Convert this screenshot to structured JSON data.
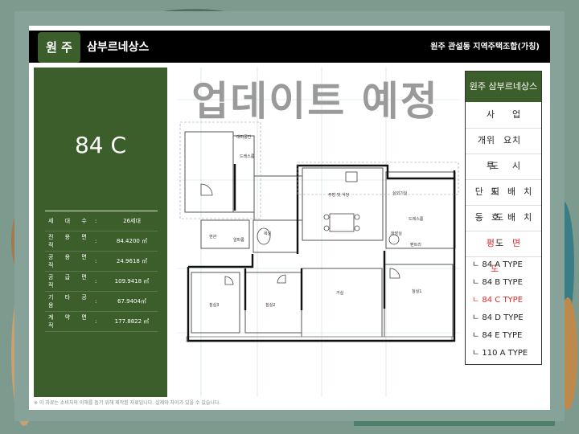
{
  "header": {
    "logo": "원 주",
    "brand": "삼부르네상스",
    "association": "원주 관설동 지역주택조합(가칭)"
  },
  "unit": {
    "type": "84 C",
    "specs": [
      {
        "label": "세 대 수",
        "value": "26세대"
      },
      {
        "label": "전 용 면 적",
        "value": "84.4200 ㎡"
      },
      {
        "label": "공 용 면 적",
        "value": "24.9618 ㎡"
      },
      {
        "label": "공 급 면 적",
        "value": "109.9418 ㎡"
      },
      {
        "label": "기 타 공 용",
        "value": "67.9404㎡"
      },
      {
        "label": "계 약 면 적",
        "value": "177.8822 ㎡"
      }
    ],
    "spec_colon": ":"
  },
  "plan": {
    "overlay": "업데이트 예정",
    "rooms": {
      "dress": "드레스룸",
      "kitchen": "주방 및 식당",
      "bath": "욕실",
      "entry": "현관",
      "bedroom1": "침실1",
      "bedroom2": "침실2",
      "bedroom3": "침실3",
      "living": "거실",
      "utility": "실외기실",
      "master_bath": "화장실",
      "alpha": "알파룸",
      "dress2": "드레스룸",
      "pantry": "팬트리",
      "storage": "대피공간"
    }
  },
  "menu": {
    "title": "원주 삼부르네상스",
    "items": [
      "사업개요",
      "위치도",
      "투시도",
      "단지배치도",
      "동호배치도",
      "평면도"
    ],
    "active_item": 5,
    "subtypes": [
      "ㄴ 84 A TYPE",
      "ㄴ 84 B TYPE",
      "ㄴ 84 C TYPE",
      "ㄴ 84 D TYPE",
      "ㄴ 84 E TYPE",
      "ㄴ 110 A TYPE"
    ],
    "active_subtype": 2
  },
  "footnote": "※ 이 자료는 소비자의 이해를 돕기 위해 제작된 자료입니다. 실제와 차이가 있을 수 있습니다.",
  "colors": {
    "brand_green": "#3b5e2b",
    "active": "#e02a2a"
  }
}
